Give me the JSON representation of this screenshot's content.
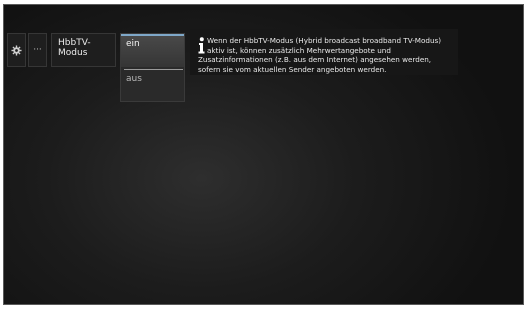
{
  "menu": {
    "settings_icon": "gear-icon",
    "more_label": "···",
    "setting_label": "HbbTV-Modus"
  },
  "options": {
    "selected": "ein",
    "items": [
      "ein",
      "aus"
    ]
  },
  "info": {
    "icon": "info-icon",
    "text": "Wenn der HbbTV-Modus (Hybrid broadcast broadband TV-Modus) aktiv ist, können zusätzlich Mehrwertangebote und Zusatzinformationen (z.B. aus dem Internet) angesehen werden, sofern sie vom aktuellen Sender angeboten werden."
  },
  "colors": {
    "accent": "#7fa8c9",
    "background": "#1c1c1c"
  }
}
